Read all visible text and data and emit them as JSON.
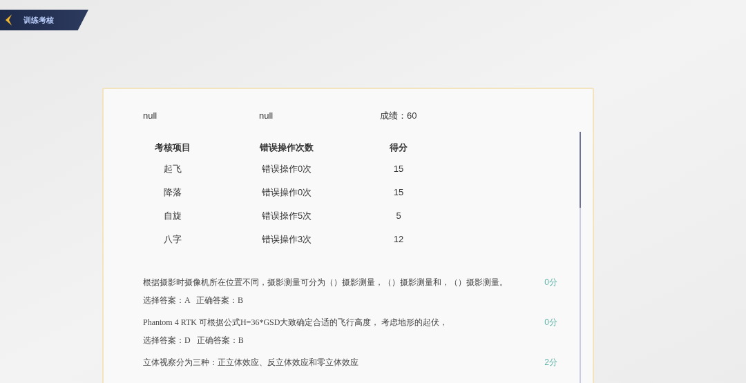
{
  "header": {
    "title": "训练考核"
  },
  "summary": {
    "field_1": "null",
    "field_2": "null",
    "score": "成绩：60"
  },
  "table": {
    "columns": [
      "考核项目",
      "错误操作次数",
      "得分"
    ],
    "rows": [
      [
        "起飞",
        "错误操作0次",
        "15"
      ],
      [
        "降落",
        "错误操作0次",
        "15"
      ],
      [
        "自旋",
        "错误操作5次",
        "5"
      ],
      [
        "八字",
        "错误操作3次",
        "12"
      ]
    ]
  },
  "questions": [
    {
      "text": "根据摄影时摄像机所在位置不同，摄影测量可分为（）摄影测量，（）摄影测量和，（）摄影测量。",
      "points": "0分",
      "answer": "选择答案：A   正确答案：B"
    },
    {
      "text": "Phantom 4 RTK 可根据公式H=36*GSD大致确定合适的飞行高度， 考虑地形的起伏，",
      "points": "0分",
      "answer": "选择答案：D   正确答案：B"
    },
    {
      "text": "立体视察分为三种：正立体效应、反立体效应和零立体效应",
      "points": "2分"
    }
  ]
}
